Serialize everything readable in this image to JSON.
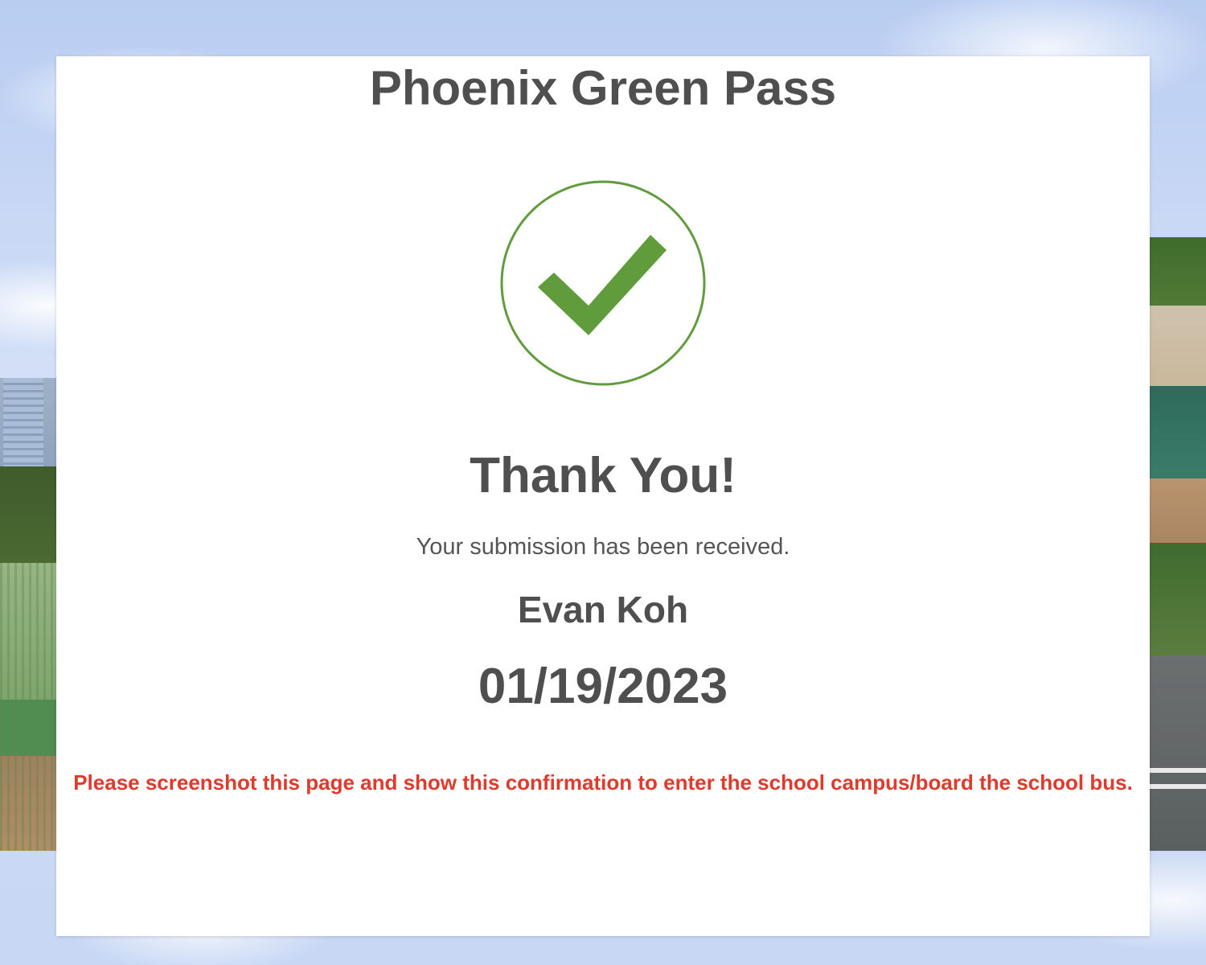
{
  "page": {
    "title": "Phoenix Green Pass"
  },
  "confirmation": {
    "icon": "check-circle-icon",
    "accent_color": "#619c3c",
    "heading": "Thank You!",
    "message": "Your submission has been received.",
    "name": "Evan Koh",
    "date": "01/19/2023"
  },
  "notice": {
    "text": "Please screenshot this page and show this confirmation to enter the school campus/board the school bus.",
    "color": "#e03a2c"
  }
}
